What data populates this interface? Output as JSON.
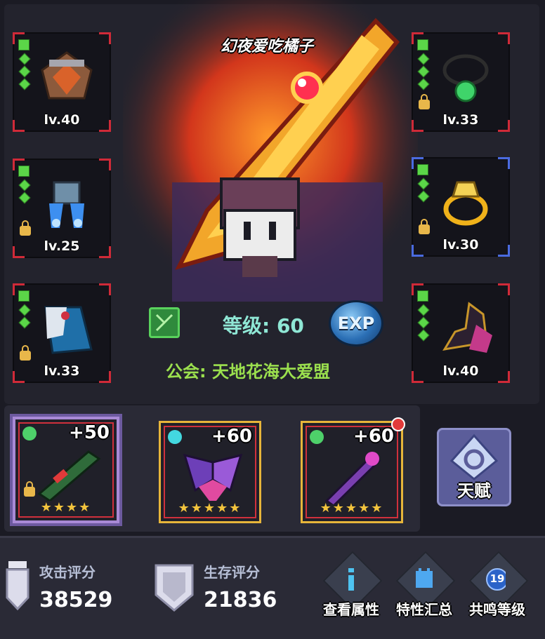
{
  "player": {
    "name": "幻夜爱吃橘子",
    "level_text": "等级: 60",
    "guild_text": "公会: 天地花海大爱盟",
    "exp_label": "EXP"
  },
  "equipment_left": [
    {
      "level": "lv.40",
      "locked": false
    },
    {
      "level": "lv.25",
      "locked": true
    },
    {
      "level": "lv.33",
      "locked": true
    }
  ],
  "equipment_right": [
    {
      "level": "lv.33",
      "locked": true
    },
    {
      "level": "lv.30",
      "locked": true
    },
    {
      "level": "lv.40",
      "locked": false
    }
  ],
  "weapons": [
    {
      "plus": "+50",
      "stars": "★★★★",
      "selected": true
    },
    {
      "plus": "+60",
      "stars": "★★★★★",
      "selected": false
    },
    {
      "plus": "+60",
      "stars": "★★★★★",
      "selected": false,
      "notification": true
    }
  ],
  "talent": {
    "label": "天赋"
  },
  "scores": {
    "attack_label": "攻击评分",
    "attack_value": "38529",
    "survival_label": "生存评分",
    "survival_value": "21836"
  },
  "actions": [
    {
      "label": "查看属性",
      "icon": "attribute-icon"
    },
    {
      "label": "特性汇总",
      "icon": "traits-icon"
    },
    {
      "label": "共鸣等级",
      "icon": "resonance-icon",
      "badge": "19"
    }
  ],
  "colors": {
    "rarity_red": "#d02a38",
    "rarity_blue": "#4a6be0",
    "gold_frame": "#e7b53a",
    "level_text": "#8fe7d5",
    "guild_text": "#9be04e"
  }
}
